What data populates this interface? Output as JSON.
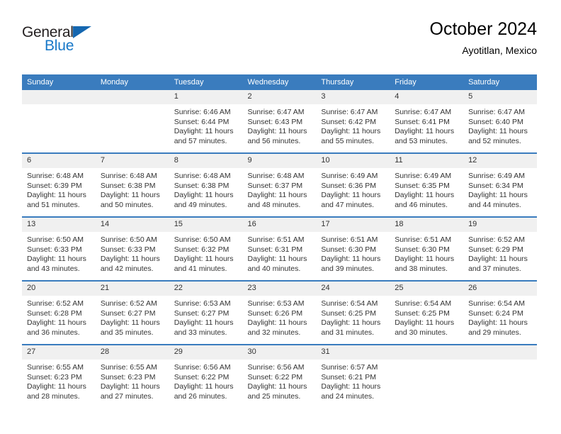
{
  "brand": {
    "name_top": "General",
    "name_bottom": "Blue",
    "accent_color": "#1878c8",
    "triangle_color": "#1567b0"
  },
  "header": {
    "title": "October 2024",
    "subtitle": "Ayotitlan, Mexico"
  },
  "calendar": {
    "header_bg": "#3a7cbe",
    "daynum_bg": "#f0f0f0",
    "weekdays": [
      "Sunday",
      "Monday",
      "Tuesday",
      "Wednesday",
      "Thursday",
      "Friday",
      "Saturday"
    ],
    "weeks": [
      [
        {
          "day": ""
        },
        {
          "day": ""
        },
        {
          "day": "1",
          "sunrise": "Sunrise: 6:46 AM",
          "sunset": "Sunset: 6:44 PM",
          "daylight": "Daylight: 11 hours and 57 minutes."
        },
        {
          "day": "2",
          "sunrise": "Sunrise: 6:47 AM",
          "sunset": "Sunset: 6:43 PM",
          "daylight": "Daylight: 11 hours and 56 minutes."
        },
        {
          "day": "3",
          "sunrise": "Sunrise: 6:47 AM",
          "sunset": "Sunset: 6:42 PM",
          "daylight": "Daylight: 11 hours and 55 minutes."
        },
        {
          "day": "4",
          "sunrise": "Sunrise: 6:47 AM",
          "sunset": "Sunset: 6:41 PM",
          "daylight": "Daylight: 11 hours and 53 minutes."
        },
        {
          "day": "5",
          "sunrise": "Sunrise: 6:47 AM",
          "sunset": "Sunset: 6:40 PM",
          "daylight": "Daylight: 11 hours and 52 minutes."
        }
      ],
      [
        {
          "day": "6",
          "sunrise": "Sunrise: 6:48 AM",
          "sunset": "Sunset: 6:39 PM",
          "daylight": "Daylight: 11 hours and 51 minutes."
        },
        {
          "day": "7",
          "sunrise": "Sunrise: 6:48 AM",
          "sunset": "Sunset: 6:38 PM",
          "daylight": "Daylight: 11 hours and 50 minutes."
        },
        {
          "day": "8",
          "sunrise": "Sunrise: 6:48 AM",
          "sunset": "Sunset: 6:38 PM",
          "daylight": "Daylight: 11 hours and 49 minutes."
        },
        {
          "day": "9",
          "sunrise": "Sunrise: 6:48 AM",
          "sunset": "Sunset: 6:37 PM",
          "daylight": "Daylight: 11 hours and 48 minutes."
        },
        {
          "day": "10",
          "sunrise": "Sunrise: 6:49 AM",
          "sunset": "Sunset: 6:36 PM",
          "daylight": "Daylight: 11 hours and 47 minutes."
        },
        {
          "day": "11",
          "sunrise": "Sunrise: 6:49 AM",
          "sunset": "Sunset: 6:35 PM",
          "daylight": "Daylight: 11 hours and 46 minutes."
        },
        {
          "day": "12",
          "sunrise": "Sunrise: 6:49 AM",
          "sunset": "Sunset: 6:34 PM",
          "daylight": "Daylight: 11 hours and 44 minutes."
        }
      ],
      [
        {
          "day": "13",
          "sunrise": "Sunrise: 6:50 AM",
          "sunset": "Sunset: 6:33 PM",
          "daylight": "Daylight: 11 hours and 43 minutes."
        },
        {
          "day": "14",
          "sunrise": "Sunrise: 6:50 AM",
          "sunset": "Sunset: 6:33 PM",
          "daylight": "Daylight: 11 hours and 42 minutes."
        },
        {
          "day": "15",
          "sunrise": "Sunrise: 6:50 AM",
          "sunset": "Sunset: 6:32 PM",
          "daylight": "Daylight: 11 hours and 41 minutes."
        },
        {
          "day": "16",
          "sunrise": "Sunrise: 6:51 AM",
          "sunset": "Sunset: 6:31 PM",
          "daylight": "Daylight: 11 hours and 40 minutes."
        },
        {
          "day": "17",
          "sunrise": "Sunrise: 6:51 AM",
          "sunset": "Sunset: 6:30 PM",
          "daylight": "Daylight: 11 hours and 39 minutes."
        },
        {
          "day": "18",
          "sunrise": "Sunrise: 6:51 AM",
          "sunset": "Sunset: 6:30 PM",
          "daylight": "Daylight: 11 hours and 38 minutes."
        },
        {
          "day": "19",
          "sunrise": "Sunrise: 6:52 AM",
          "sunset": "Sunset: 6:29 PM",
          "daylight": "Daylight: 11 hours and 37 minutes."
        }
      ],
      [
        {
          "day": "20",
          "sunrise": "Sunrise: 6:52 AM",
          "sunset": "Sunset: 6:28 PM",
          "daylight": "Daylight: 11 hours and 36 minutes."
        },
        {
          "day": "21",
          "sunrise": "Sunrise: 6:52 AM",
          "sunset": "Sunset: 6:27 PM",
          "daylight": "Daylight: 11 hours and 35 minutes."
        },
        {
          "day": "22",
          "sunrise": "Sunrise: 6:53 AM",
          "sunset": "Sunset: 6:27 PM",
          "daylight": "Daylight: 11 hours and 33 minutes."
        },
        {
          "day": "23",
          "sunrise": "Sunrise: 6:53 AM",
          "sunset": "Sunset: 6:26 PM",
          "daylight": "Daylight: 11 hours and 32 minutes."
        },
        {
          "day": "24",
          "sunrise": "Sunrise: 6:54 AM",
          "sunset": "Sunset: 6:25 PM",
          "daylight": "Daylight: 11 hours and 31 minutes."
        },
        {
          "day": "25",
          "sunrise": "Sunrise: 6:54 AM",
          "sunset": "Sunset: 6:25 PM",
          "daylight": "Daylight: 11 hours and 30 minutes."
        },
        {
          "day": "26",
          "sunrise": "Sunrise: 6:54 AM",
          "sunset": "Sunset: 6:24 PM",
          "daylight": "Daylight: 11 hours and 29 minutes."
        }
      ],
      [
        {
          "day": "27",
          "sunrise": "Sunrise: 6:55 AM",
          "sunset": "Sunset: 6:23 PM",
          "daylight": "Daylight: 11 hours and 28 minutes."
        },
        {
          "day": "28",
          "sunrise": "Sunrise: 6:55 AM",
          "sunset": "Sunset: 6:23 PM",
          "daylight": "Daylight: 11 hours and 27 minutes."
        },
        {
          "day": "29",
          "sunrise": "Sunrise: 6:56 AM",
          "sunset": "Sunset: 6:22 PM",
          "daylight": "Daylight: 11 hours and 26 minutes."
        },
        {
          "day": "30",
          "sunrise": "Sunrise: 6:56 AM",
          "sunset": "Sunset: 6:22 PM",
          "daylight": "Daylight: 11 hours and 25 minutes."
        },
        {
          "day": "31",
          "sunrise": "Sunrise: 6:57 AM",
          "sunset": "Sunset: 6:21 PM",
          "daylight": "Daylight: 11 hours and 24 minutes."
        },
        {
          "day": ""
        },
        {
          "day": ""
        }
      ]
    ]
  }
}
